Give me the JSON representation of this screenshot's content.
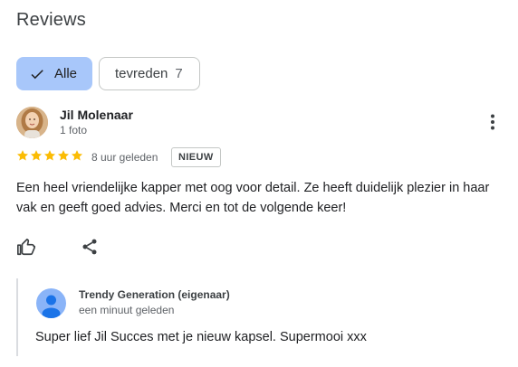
{
  "section": {
    "title": "Reviews"
  },
  "filters": [
    {
      "label": "Alle",
      "selected": true,
      "icon": "check-icon"
    },
    {
      "label": "tevreden",
      "count": "7",
      "selected": false
    }
  ],
  "review": {
    "author": "Jil Molenaar",
    "meta": "1 foto",
    "rating": 5,
    "time": "8 uur geleden",
    "badge": "NIEUW",
    "text": "Een heel vriendelijke kapper met oog voor detail. Ze heeft duidelijk plezier in haar vak en geeft goed advies. Merci en tot de volgende keer!",
    "star_color": "#fbbc04"
  },
  "owner_reply": {
    "author": "Trendy Generation (eigenaar)",
    "time": "een minuut geleden",
    "text": "Super lief Jil Succes met je nieuw kapsel. Supermooi xxx"
  },
  "colors": {
    "accent_chip": "#a8c7fa",
    "text_secondary": "#5f6368"
  }
}
